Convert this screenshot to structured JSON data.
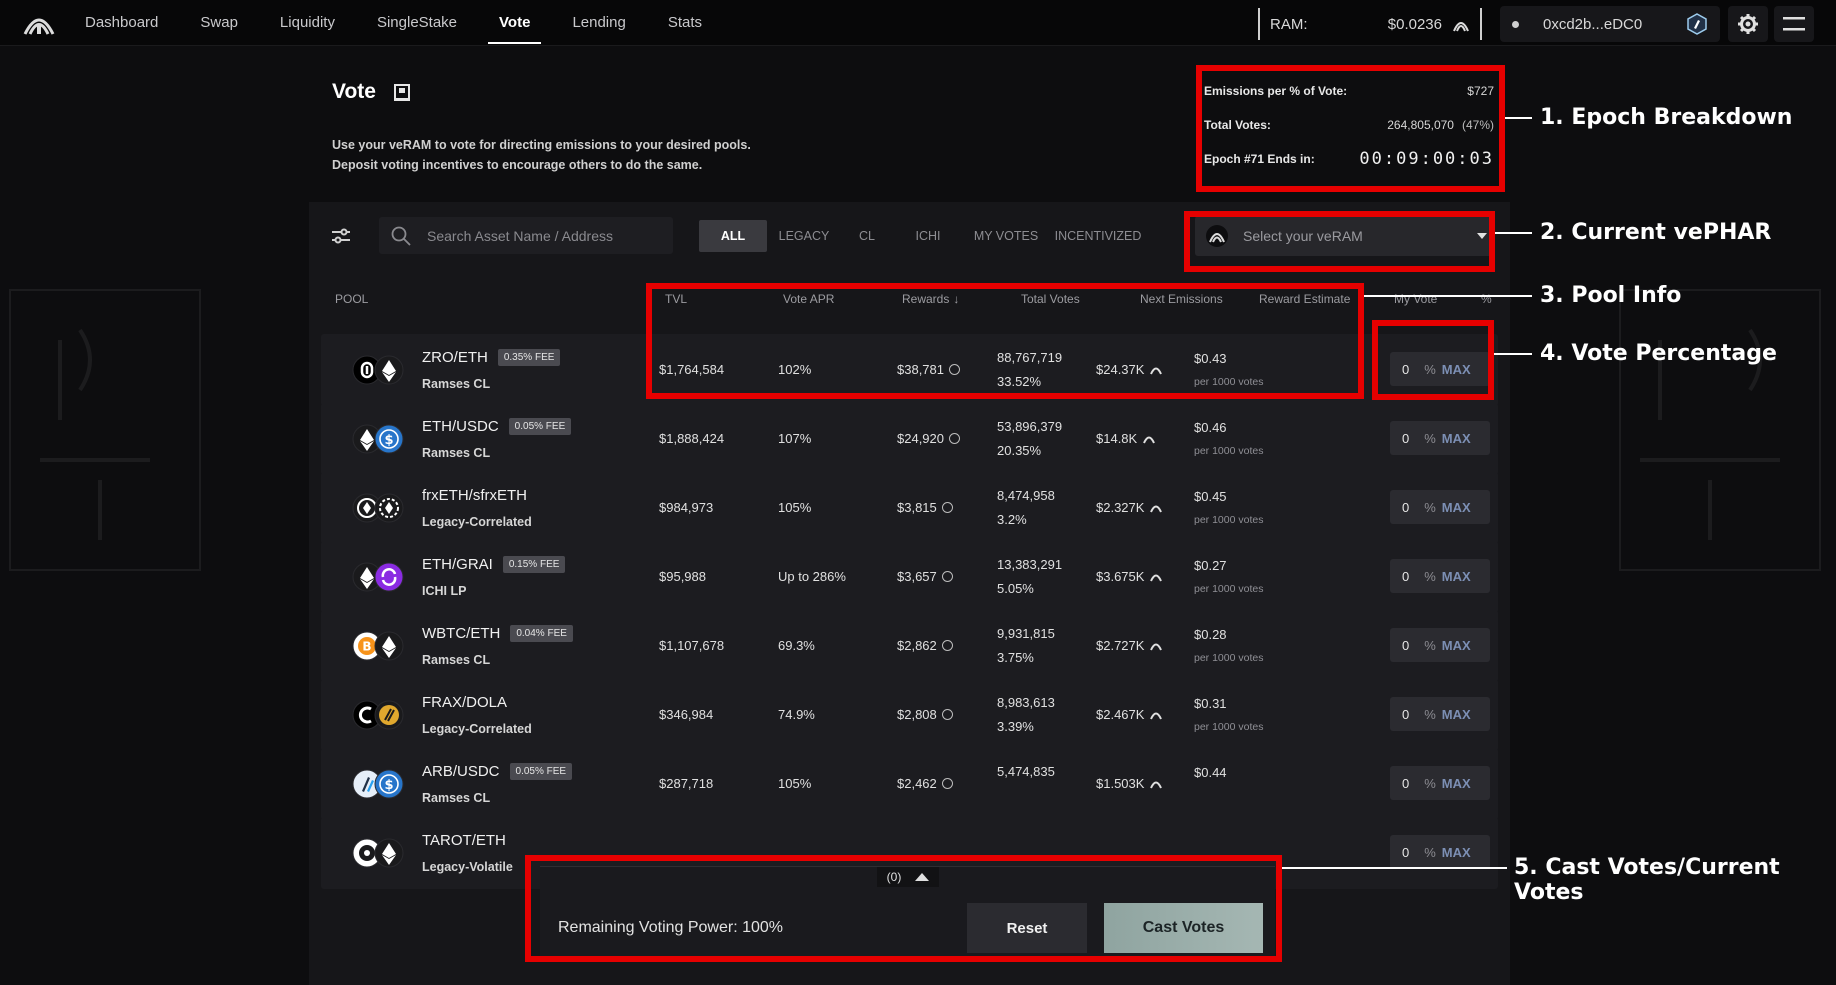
{
  "nav": {
    "items": [
      {
        "label": "Dashboard",
        "active": false
      },
      {
        "label": "Swap",
        "active": false
      },
      {
        "label": "Liquidity",
        "active": false
      },
      {
        "label": "SingleStake",
        "active": false
      },
      {
        "label": "Vote",
        "active": true
      },
      {
        "label": "Lending",
        "active": false
      },
      {
        "label": "Stats",
        "active": false
      }
    ],
    "ram_label": "RAM:",
    "ram_price": "$0.0236",
    "wallet": "0xcd2b...eDC0"
  },
  "header": {
    "title": "Vote",
    "description_line1": "Use your veRAM to vote for directing emissions to your desired pools.",
    "description_line2": "Deposit voting incentives to encourage others to do the same."
  },
  "epoch": {
    "emissions_label": "Emissions per % of Vote:",
    "emissions_value": "$727",
    "total_votes_label": "Total Votes:",
    "total_votes_value": "264,805,070",
    "total_votes_pct": "(47%)",
    "ends_label": "Epoch #71 Ends in:",
    "countdown": "00:09:00:03"
  },
  "filters": {
    "search_placeholder": "Search Asset Name / Address",
    "tabs": [
      "ALL",
      "LEGACY",
      "CL",
      "ICHI",
      "MY VOTES",
      "INCENTIVIZED"
    ],
    "active_tab": "ALL",
    "veram_placeholder": "Select your veRAM"
  },
  "table": {
    "headers": {
      "pool": "POOL",
      "tvl": "TVL",
      "vote_apr": "Vote APR",
      "rewards": "Rewards",
      "total_votes": "Total Votes",
      "next_emissions": "Next Emissions",
      "reward_estimate": "Reward Estimate",
      "my_vote": "My Vote",
      "pct": "%"
    },
    "rows": [
      {
        "pool": "ZRO/ETH",
        "fee": "0.35% FEE",
        "type": "Ramses CL",
        "tvl": "$1,764,584",
        "apr": "102%",
        "rewards": "$38,781",
        "votes": "88,767,719",
        "votes_pct": "33.52%",
        "emissions": "$24.37K",
        "estimate": "$0.43",
        "estimate_sub": "per 1000 votes",
        "my_vote": "0",
        "pct_sign": "%",
        "max": "MAX",
        "icons": [
          "zro-icon",
          "eth-icon"
        ]
      },
      {
        "pool": "ETH/USDC",
        "fee": "0.05% FEE",
        "type": "Ramses CL",
        "tvl": "$1,888,424",
        "apr": "107%",
        "rewards": "$24,920",
        "votes": "53,896,379",
        "votes_pct": "20.35%",
        "emissions": "$14.8K",
        "estimate": "$0.46",
        "estimate_sub": "per 1000 votes",
        "my_vote": "0",
        "pct_sign": "%",
        "max": "MAX",
        "icons": [
          "eth-icon",
          "usdc-icon"
        ]
      },
      {
        "pool": "frxETH/sfrxETH",
        "fee": "",
        "type": "Legacy-Correlated",
        "tvl": "$984,973",
        "apr": "105%",
        "rewards": "$3,815",
        "votes": "8,474,958",
        "votes_pct": "3.2%",
        "emissions": "$2.327K",
        "estimate": "$0.45",
        "estimate_sub": "per 1000 votes",
        "my_vote": "0",
        "pct_sign": "%",
        "max": "MAX",
        "icons": [
          "frxeth-icon",
          "sfrxeth-icon"
        ]
      },
      {
        "pool": "ETH/GRAI",
        "fee": "0.15% FEE",
        "type": "ICHI LP",
        "tvl": "$95,988",
        "apr": "Up to 286%",
        "rewards": "$3,657",
        "votes": "13,383,291",
        "votes_pct": "5.05%",
        "emissions": "$3.675K",
        "estimate": "$0.27",
        "estimate_sub": "per 1000 votes",
        "my_vote": "0",
        "pct_sign": "%",
        "max": "MAX",
        "icons": [
          "eth-icon",
          "grai-icon"
        ]
      },
      {
        "pool": "WBTC/ETH",
        "fee": "0.04% FEE",
        "type": "Ramses CL",
        "tvl": "$1,107,678",
        "apr": "69.3%",
        "rewards": "$2,862",
        "votes": "9,931,815",
        "votes_pct": "3.75%",
        "emissions": "$2.727K",
        "estimate": "$0.28",
        "estimate_sub": "per 1000 votes",
        "my_vote": "0",
        "pct_sign": "%",
        "max": "MAX",
        "icons": [
          "wbtc-icon",
          "eth-icon"
        ]
      },
      {
        "pool": "FRAX/DOLA",
        "fee": "",
        "type": "Legacy-Correlated",
        "tvl": "$346,984",
        "apr": "74.9%",
        "rewards": "$2,808",
        "votes": "8,983,613",
        "votes_pct": "3.39%",
        "emissions": "$2.467K",
        "estimate": "$0.31",
        "estimate_sub": "per 1000 votes",
        "my_vote": "0",
        "pct_sign": "%",
        "max": "MAX",
        "icons": [
          "frax-icon",
          "dola-icon"
        ]
      },
      {
        "pool": "ARB/USDC",
        "fee": "0.05% FEE",
        "type": "Ramses CL",
        "tvl": "$287,718",
        "apr": "105%",
        "rewards": "$2,462",
        "votes": "5,474,835",
        "votes_pct": "",
        "emissions": "$1.503K",
        "estimate": "$0.44",
        "estimate_sub": "",
        "my_vote": "0",
        "pct_sign": "%",
        "max": "MAX",
        "icons": [
          "arb-icon",
          "usdc-icon"
        ]
      },
      {
        "pool": "TAROT/ETH",
        "fee": "",
        "type": "Legacy-Volatile",
        "tvl": "",
        "apr": "",
        "rewards": "",
        "votes": "",
        "votes_pct": "",
        "emissions": "",
        "estimate": "",
        "estimate_sub": "",
        "my_vote": "0",
        "pct_sign": "%",
        "max": "MAX",
        "icons": [
          "tarot-icon",
          "eth-icon"
        ]
      }
    ]
  },
  "castbar": {
    "count": "(0)",
    "remaining": "Remaining Voting Power: 100%",
    "reset": "Reset",
    "cast": "Cast Votes"
  },
  "annotations": {
    "a1": "1. Epoch Breakdown",
    "a2": "2. Current vePHAR",
    "a3": "3. Pool Info",
    "a4": "4. Vote Percentage",
    "a5": "5. Cast Votes/Current Votes"
  },
  "colors": {
    "highlight": "#e60000",
    "cast_button": "#9fb2ae",
    "max_link": "#7c8fb4"
  }
}
